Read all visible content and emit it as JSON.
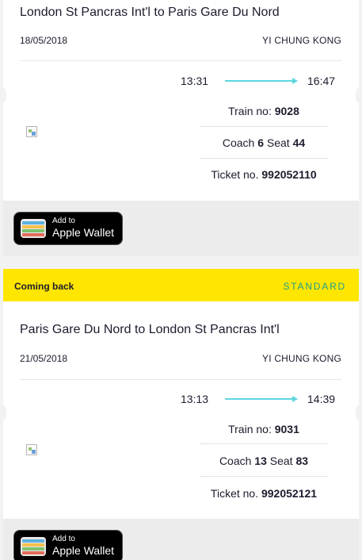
{
  "outbound": {
    "route": "London St Pancras Int'l to Paris Gare Du Nord",
    "date": "18/05/2018",
    "passenger": "YI CHUNG KONG",
    "depart_time": "13:31",
    "arrive_time": "16:47",
    "train_label": "Train no:",
    "train_no": "9028",
    "coach_label": "Coach",
    "coach": "6",
    "seat_label": "Seat",
    "seat": "44",
    "ticket_label": "Ticket no.",
    "ticket_no": "992052110"
  },
  "return_banner": {
    "title": "Coming back",
    "class_label": "STANDARD"
  },
  "inbound": {
    "route": "Paris Gare Du Nord to London St Pancras Int'l",
    "date": "21/05/2018",
    "passenger": "YI CHUNG KONG",
    "depart_time": "13:13",
    "arrive_time": "14:39",
    "train_label": "Train no:",
    "train_no": "9031",
    "coach_label": "Coach",
    "coach": "13",
    "seat_label": "Seat",
    "seat": "83",
    "ticket_label": "Ticket no.",
    "ticket_no": "992052121"
  },
  "wallet_button": {
    "small_label": "Add to",
    "big_label": "Apple Wallet"
  },
  "colors": {
    "banner_yellow": "#ffe600",
    "standard_green": "#1b9f8a",
    "arrow_cyan": "#5ed6e0"
  }
}
